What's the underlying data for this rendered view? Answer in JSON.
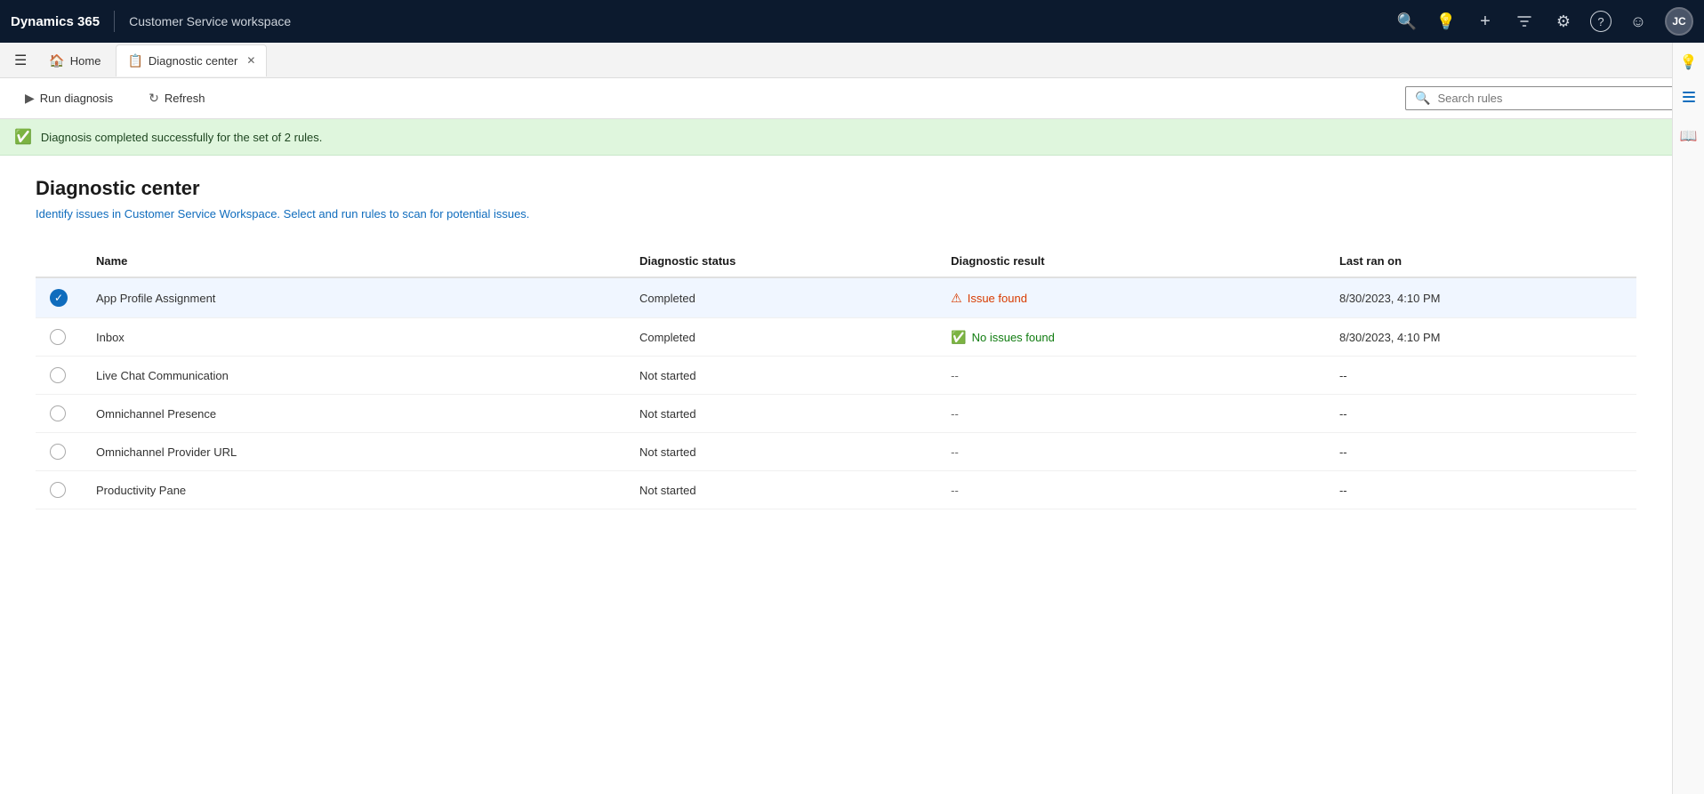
{
  "app": {
    "brand": "Dynamics 365",
    "workspace_title": "Customer Service workspace"
  },
  "nav_icons": [
    {
      "name": "search-icon",
      "symbol": "🔍"
    },
    {
      "name": "lightbulb-icon",
      "symbol": "💡"
    },
    {
      "name": "plus-icon",
      "symbol": "+"
    },
    {
      "name": "filter-icon",
      "symbol": "⚗"
    },
    {
      "name": "settings-icon",
      "symbol": "⚙"
    },
    {
      "name": "help-icon",
      "symbol": "?"
    },
    {
      "name": "smiley-icon",
      "symbol": "☺"
    }
  ],
  "avatar": {
    "label": "JC"
  },
  "tabs": [
    {
      "id": "home",
      "label": "Home",
      "icon": "🏠",
      "active": false,
      "closable": false
    },
    {
      "id": "diagnostic",
      "label": "Diagnostic center",
      "icon": "📋",
      "active": true,
      "closable": true
    }
  ],
  "side_icons": [
    {
      "name": "bulb-side-icon",
      "symbol": "💡"
    },
    {
      "name": "list-side-icon",
      "symbol": "☰"
    },
    {
      "name": "book-side-icon",
      "symbol": "📖"
    }
  ],
  "toolbar": {
    "run_diagnosis_label": "Run diagnosis",
    "refresh_label": "Refresh",
    "search_placeholder": "Search rules"
  },
  "banner": {
    "message": "Diagnosis completed successfully for the set of 2 rules."
  },
  "page": {
    "title": "Diagnostic center",
    "subtitle": "Identify issues in Customer Service Workspace. Select and run rules to scan for potential issues."
  },
  "table": {
    "columns": [
      "Name",
      "Diagnostic status",
      "Diagnostic result",
      "Last ran on"
    ],
    "rows": [
      {
        "id": "app-profile",
        "name": "App Profile Assignment",
        "status": "Completed",
        "result_type": "issue",
        "result_label": "Issue found",
        "last_ran": "8/30/2023, 4:10 PM",
        "selected": true
      },
      {
        "id": "inbox",
        "name": "Inbox",
        "status": "Completed",
        "result_type": "ok",
        "result_label": "No issues found",
        "last_ran": "8/30/2023, 4:10 PM",
        "selected": false
      },
      {
        "id": "live-chat",
        "name": "Live Chat Communication",
        "status": "Not started",
        "result_type": "empty",
        "result_label": "--",
        "last_ran": "--",
        "selected": false
      },
      {
        "id": "omnichannel-presence",
        "name": "Omnichannel Presence",
        "status": "Not started",
        "result_type": "empty",
        "result_label": "--",
        "last_ran": "--",
        "selected": false
      },
      {
        "id": "omnichannel-provider",
        "name": "Omnichannel Provider URL",
        "status": "Not started",
        "result_type": "empty",
        "result_label": "--",
        "last_ran": "--",
        "selected": false
      },
      {
        "id": "productivity-pane",
        "name": "Productivity Pane",
        "status": "Not started",
        "result_type": "empty",
        "result_label": "--",
        "last_ran": "--",
        "selected": false
      }
    ]
  }
}
